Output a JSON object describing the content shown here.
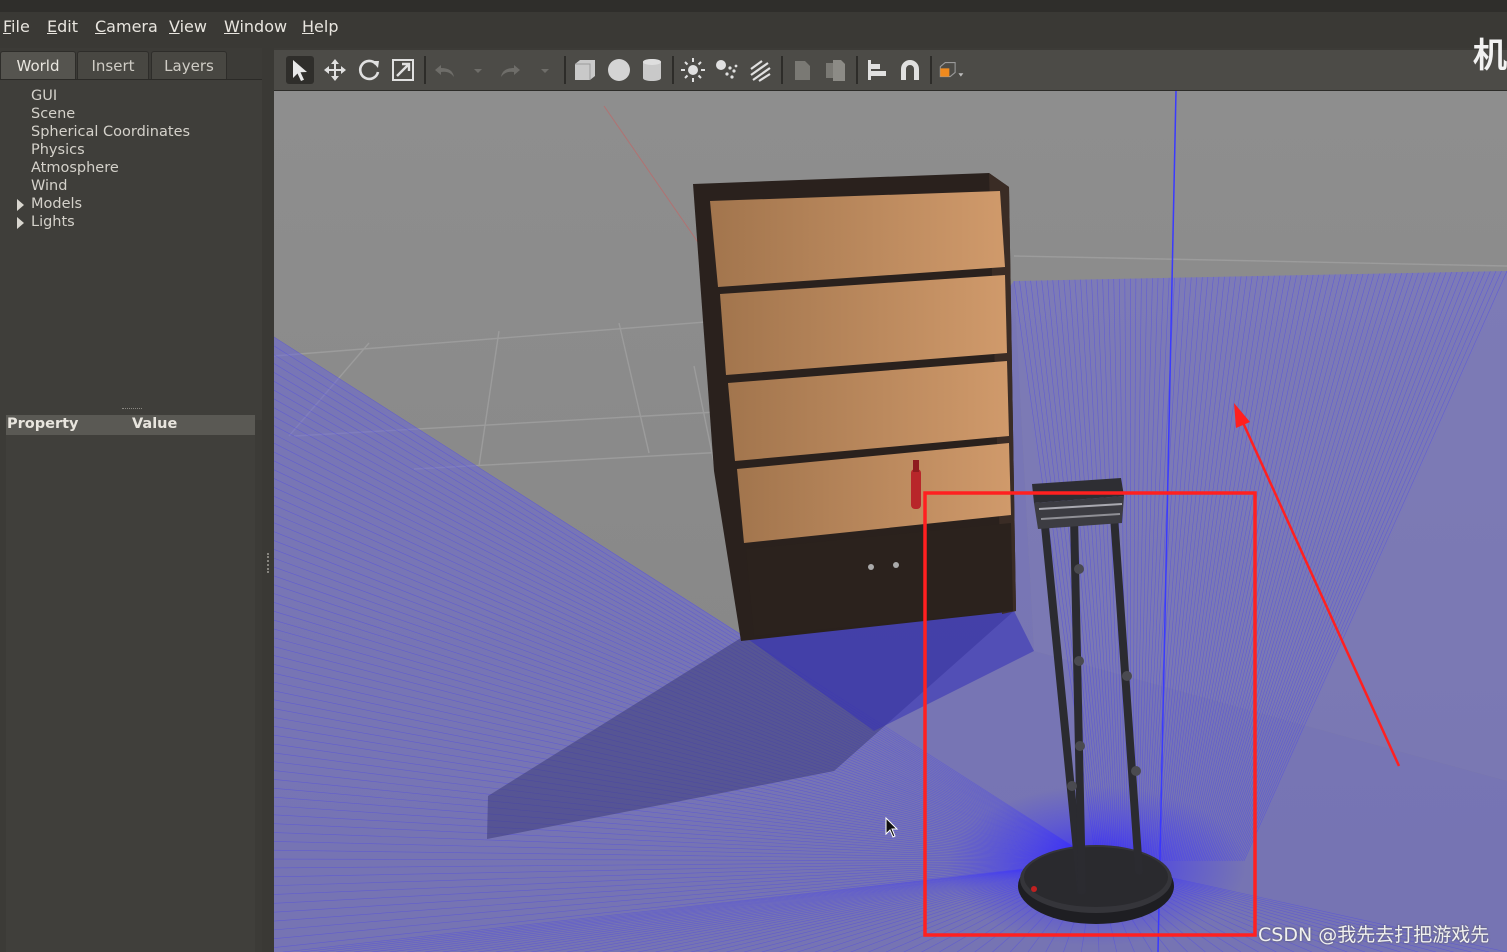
{
  "menu": [
    "File",
    "Edit",
    "Camera",
    "View",
    "Window",
    "Help"
  ],
  "corner_text": "机",
  "tabs": [
    {
      "label": "World",
      "active": true
    },
    {
      "label": "Insert",
      "active": false
    },
    {
      "label": "Layers",
      "active": false
    }
  ],
  "world_tree": [
    {
      "label": "GUI",
      "expandable": false
    },
    {
      "label": "Scene",
      "expandable": false
    },
    {
      "label": "Spherical Coordinates",
      "expandable": false
    },
    {
      "label": "Physics",
      "expandable": false
    },
    {
      "label": "Atmosphere",
      "expandable": false
    },
    {
      "label": "Wind",
      "expandable": false
    },
    {
      "label": "Models",
      "expandable": true
    },
    {
      "label": "Lights",
      "expandable": true
    }
  ],
  "property_table": {
    "col1": "Property",
    "col2": "Value"
  },
  "toolbar": [
    "select-arrow-icon",
    "translate-icon",
    "rotate-icon",
    "scale-icon",
    "undo-icon",
    "undo-dropdown-icon",
    "redo-icon",
    "redo-dropdown-icon",
    "box-shape-icon",
    "sphere-shape-icon",
    "cylinder-shape-icon",
    "point-light-icon",
    "spot-light-icon",
    "directional-light-icon",
    "copy-icon",
    "paste-icon",
    "align-icon",
    "snap-magnet-icon",
    "view-angle-icon"
  ],
  "watermark": "CSDN @我先去打把游戏先",
  "colors": {
    "laser": "#3a32ff",
    "annotation": "#ff2020",
    "ground": "#8c8c8c",
    "shelf_wood": "#c08a5c"
  }
}
